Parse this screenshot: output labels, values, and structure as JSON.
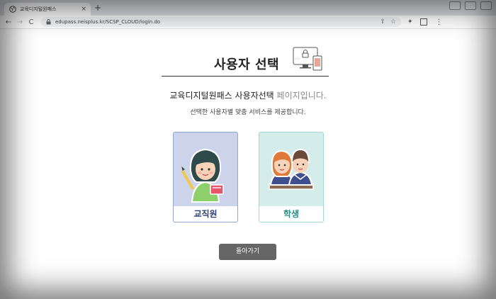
{
  "browser": {
    "tab_title": "교육디지털원패스",
    "tab_close": "×",
    "new_tab": "+",
    "tab_list_chevron": "⌄",
    "url": "edupass.neisplus.kr/SCSP_CLOUD/login.do",
    "icons": {
      "back": "←",
      "forward": "→",
      "reload": "C",
      "share": "⇪",
      "star": "☆",
      "extensions": "✦",
      "menu": "⋮"
    }
  },
  "page": {
    "title": "사용자 선택",
    "headline_main": "교육디지털원패스 사용자선택",
    "headline_muted": " 페이지입니다.",
    "subline": "선택한 사용자별 맞춤 서비스를 제공합니다.",
    "cards": [
      {
        "label": "교직원"
      },
      {
        "label": "학생"
      }
    ],
    "back_button": "돌아가기"
  },
  "colors": {
    "staff_card_bg": "#ccd4ec",
    "staff_label": "#2f3f78",
    "student_card_bg": "#d4ecea",
    "student_label": "#2a8c86",
    "back_button_bg": "#666666"
  }
}
